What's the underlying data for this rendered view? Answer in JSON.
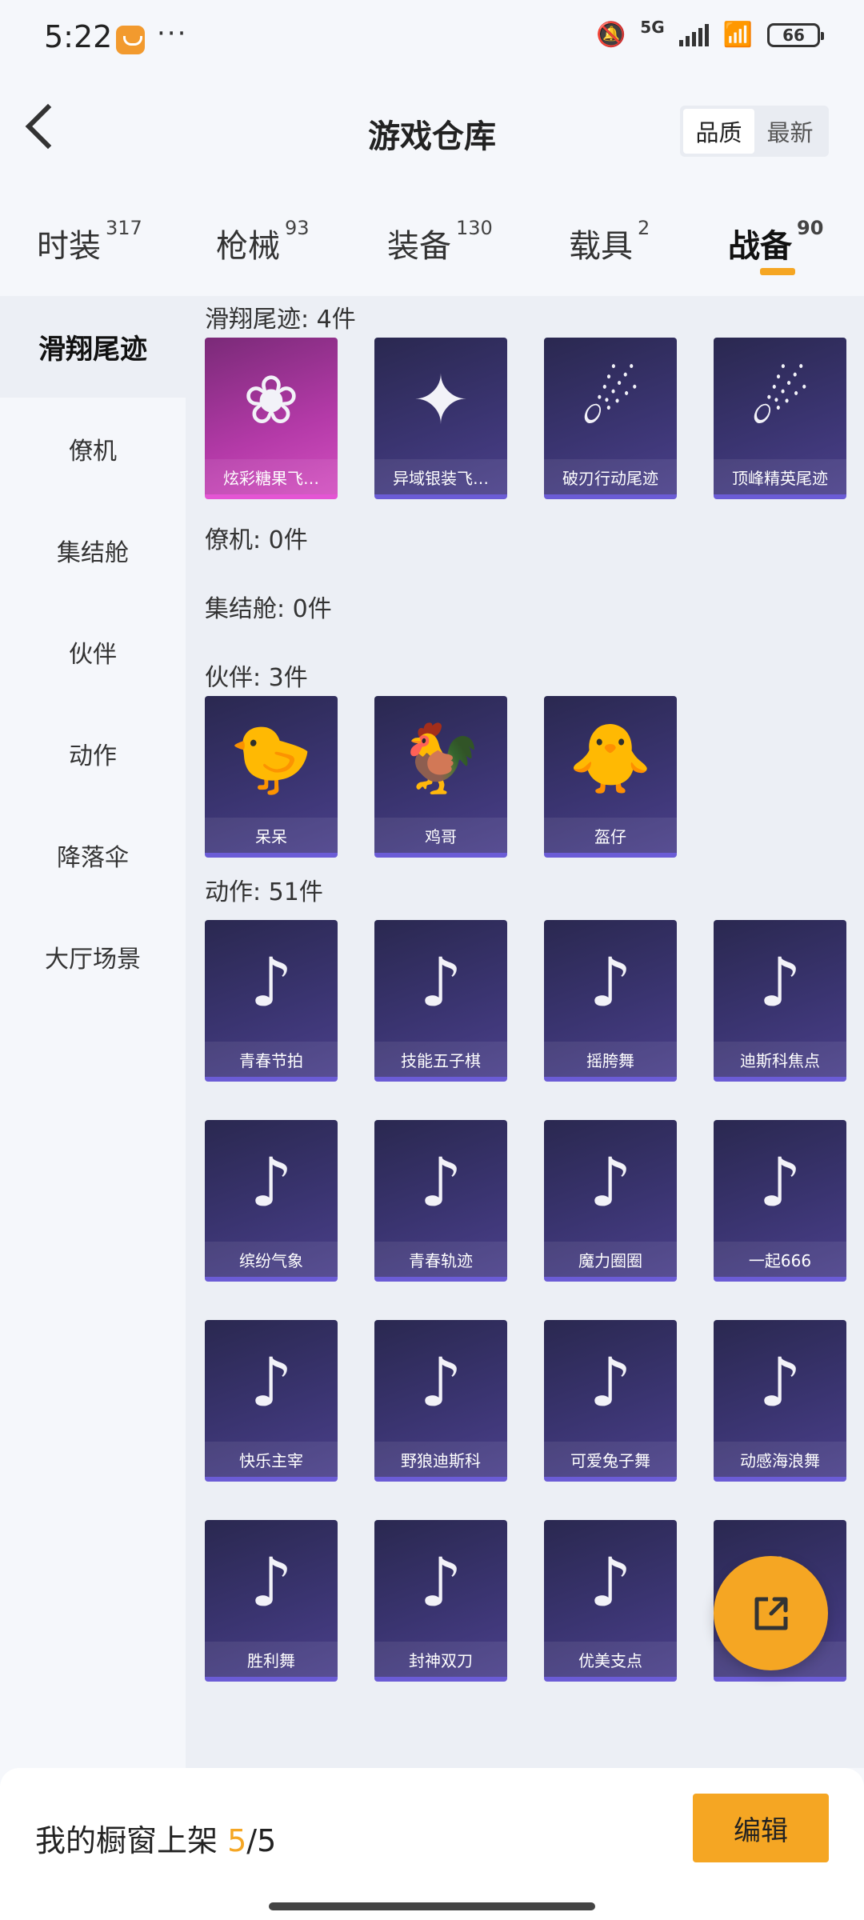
{
  "status_bar": {
    "time": "5:22",
    "more": "···",
    "network": "5G",
    "battery": "66"
  },
  "header": {
    "title": "游戏仓库",
    "sort": {
      "quality": "品质",
      "newest": "最新"
    }
  },
  "tabs": [
    {
      "label": "时装",
      "count": "317"
    },
    {
      "label": "枪械",
      "count": "93"
    },
    {
      "label": "装备",
      "count": "130"
    },
    {
      "label": "载具",
      "count": "2"
    },
    {
      "label": "战备",
      "count": "90"
    }
  ],
  "sidebar": [
    "滑翔尾迹",
    "僚机",
    "集结舱",
    "伙伴",
    "动作",
    "降落伞",
    "大厅场景"
  ],
  "sections": {
    "glide": {
      "title": "滑翔尾迹: 4件",
      "items": [
        {
          "name": "炫彩糖果飞…",
          "icon": "candy-wings-icon",
          "glyph": "❀"
        },
        {
          "name": "异域银装飞…",
          "icon": "silver-wings-icon",
          "glyph": "✦"
        },
        {
          "name": "破刃行动尾迹",
          "icon": "trail-figure-icon",
          "glyph": "☄"
        },
        {
          "name": "顶峰精英尾迹",
          "icon": "trail-figure-icon",
          "glyph": "☄"
        }
      ]
    },
    "wingman": {
      "title": "僚机: 0件"
    },
    "pod": {
      "title": "集结舱: 0件"
    },
    "partner": {
      "title": "伙伴: 3件",
      "items": [
        {
          "name": "呆呆",
          "icon": "chick-icon",
          "glyph": "🐤"
        },
        {
          "name": "鸡哥",
          "icon": "rooster-icon",
          "glyph": "🐓"
        },
        {
          "name": "盔仔",
          "icon": "helmet-chick-icon",
          "glyph": "🐥"
        }
      ]
    },
    "emote": {
      "title": "动作: 51件",
      "items": [
        {
          "name": "青春节拍",
          "glyph": "♪"
        },
        {
          "name": "技能五子棋",
          "glyph": "♪"
        },
        {
          "name": "摇胯舞",
          "glyph": "♪"
        },
        {
          "name": "迪斯科焦点",
          "glyph": "♪"
        },
        {
          "name": "缤纷气象",
          "glyph": "♪"
        },
        {
          "name": "青春轨迹",
          "glyph": "♪"
        },
        {
          "name": "魔力圈圈",
          "glyph": "♪"
        },
        {
          "name": "一起666",
          "glyph": "♪"
        },
        {
          "name": "快乐主宰",
          "glyph": "♪"
        },
        {
          "name": "野狼迪斯科",
          "glyph": "♪"
        },
        {
          "name": "可爱兔子舞",
          "glyph": "♪"
        },
        {
          "name": "动感海浪舞",
          "glyph": "♪"
        },
        {
          "name": "胜利舞",
          "glyph": "♪"
        },
        {
          "name": "封神双刀",
          "glyph": "♪"
        },
        {
          "name": "优美支点",
          "glyph": "♪"
        },
        {
          "name": "",
          "glyph": "♪"
        }
      ]
    }
  },
  "bottom": {
    "showcase_label": "我的橱窗上架",
    "showcase_used": "5",
    "showcase_sep": "/",
    "showcase_total": "5",
    "edit": "编辑"
  }
}
